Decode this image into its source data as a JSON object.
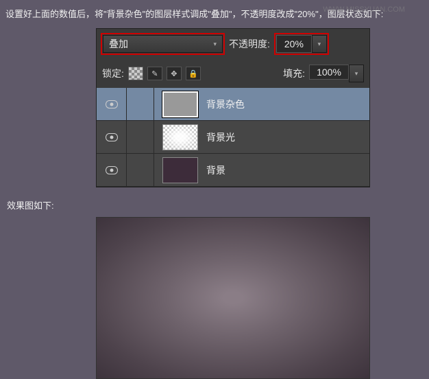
{
  "instruction": "设置好上面的数值后，将\"背景杂色\"的图层样式调成\"叠加\"，不透明度改成\"20%\"，图层状态如下:",
  "watermark": "WWW.MISSYUAN.COM",
  "panel": {
    "blend_mode": "叠加",
    "opacity_label": "不透明度:",
    "opacity_value": "20%",
    "lock_label": "锁定:",
    "fill_label": "填充:",
    "fill_value": "100%"
  },
  "layers": [
    {
      "name": "背景杂色",
      "selected": true
    },
    {
      "name": "背景光",
      "selected": false
    },
    {
      "name": "背景",
      "selected": false
    }
  ],
  "result_label": "效果图如下:"
}
